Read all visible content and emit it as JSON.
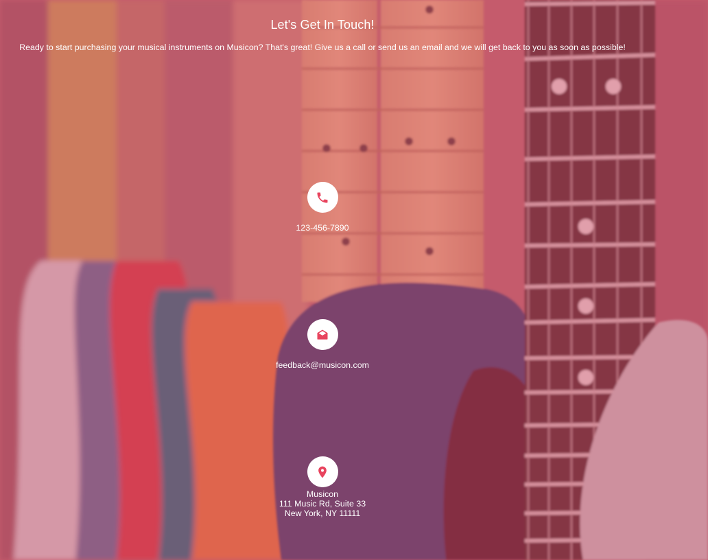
{
  "header": {
    "title": "Let's Get In Touch!",
    "intro": "Ready to start purchasing your musical instruments on Musicon? That's great! Give us a call or send us an email and we will get back to you as soon as possible!"
  },
  "contacts": {
    "phone": {
      "icon": "phone-icon",
      "value": "123-456-7890"
    },
    "email": {
      "icon": "envelope-icon",
      "value": "feedback@musicon.com"
    },
    "address": {
      "icon": "location-pin-icon",
      "lines": [
        "Musicon",
        "111 Music Rd, Suite 33",
        "New York, NY 11111"
      ]
    }
  },
  "colors": {
    "overlay": "#d64864",
    "icon_accent": "#e8445e",
    "icon_background": "#ffffff",
    "text": "#ffffff"
  }
}
